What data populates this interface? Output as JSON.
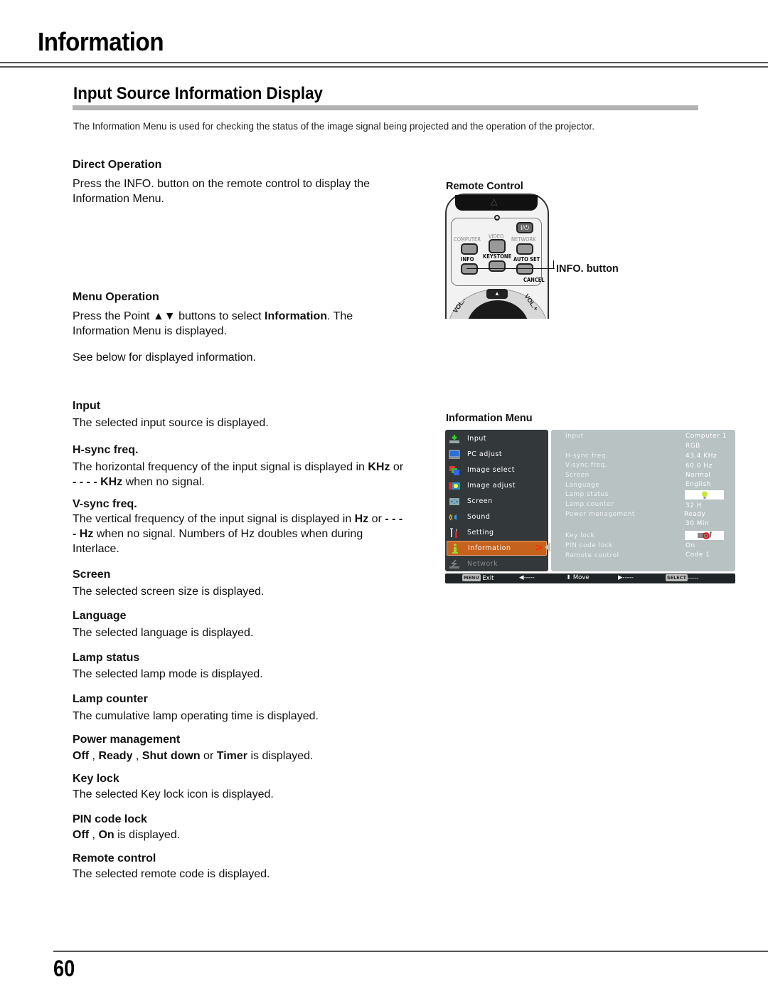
{
  "page": {
    "title": "Information",
    "section_title": "Input Source Information Display",
    "intro": "The Information Menu is used for checking the status of the image signal being projected and the operation of the projector.",
    "page_number": "60"
  },
  "direct_operation": {
    "heading": "Direct Operation",
    "text": "Press the INFO. button on the remote control to display the Information Menu."
  },
  "menu_operation": {
    "heading": "Menu Operation",
    "text_before": "Press the Point ▲▼ buttons to select ",
    "text_bold": "Information",
    "text_after": ". The Information Menu is displayed.",
    "see_below": "See below for displayed information."
  },
  "descriptions": {
    "input": {
      "heading": "Input",
      "text": "The selected input source is displayed."
    },
    "hsync": {
      "heading": "H-sync freq.",
      "t1": "The horizontal frequency of the input signal is displayed in ",
      "b1": "KHz",
      "t2": " or ",
      "b2": "- - - - KHz",
      "t3": " when no signal."
    },
    "vsync": {
      "heading": "V-sync freq.",
      "t1": "The vertical frequency of the input signal is displayed in ",
      "b1": "Hz",
      "t2": " or ",
      "b2": "- - - - Hz",
      "t3": "  when no signal. Numbers of Hz doubles when during Interlace."
    },
    "screen": {
      "heading": "Screen",
      "text": "The selected screen size is displayed."
    },
    "language": {
      "heading": "Language",
      "text": "The selected language is displayed."
    },
    "lamp_status": {
      "heading": "Lamp status",
      "text": "The selected lamp mode is displayed."
    },
    "lamp_counter": {
      "heading": "Lamp counter",
      "text": "The cumulative lamp operating time is displayed."
    },
    "power_management": {
      "heading": "Power management",
      "b1": "Off",
      "t1": " , ",
      "b2": "Ready",
      "t2": " , ",
      "b3": "Shut down",
      "t3": " or ",
      "b4": "Timer",
      "t4": " is displayed."
    },
    "key_lock": {
      "heading": "Key lock",
      "text": "The selected Key lock icon is displayed."
    },
    "pin_code_lock": {
      "heading": "PIN code lock",
      "b1": "Off",
      "t1": " , ",
      "b2": "On",
      "t2": " is displayed."
    },
    "remote_control": {
      "heading": "Remote control",
      "text": "The selected remote code  is displayed."
    }
  },
  "remote_figure": {
    "label": "Remote Control",
    "callout": "INFO. button",
    "buttons": {
      "power": "I/⏻",
      "computer": "COMPUTER",
      "video": "VIDEO",
      "network": "NETWORK",
      "info": "INFO",
      "keystone": "KEYSTONE",
      "auto_set": "AUTO SET",
      "cancel": "CANCEL",
      "vol_minus": "VOL.-",
      "vol_plus": "VOL.+",
      "up": "▲"
    }
  },
  "info_menu_figure": {
    "label": "Information Menu",
    "menu_items": [
      {
        "label": "Input",
        "icon": "input-icon"
      },
      {
        "label": "PC adjust",
        "icon": "pc-adjust-icon"
      },
      {
        "label": "Image select",
        "icon": "image-select-icon"
      },
      {
        "label": "Image adjust",
        "icon": "image-adjust-icon"
      },
      {
        "label": "Screen",
        "icon": "screen-icon"
      },
      {
        "label": "Sound",
        "icon": "sound-icon"
      },
      {
        "label": "Setting",
        "icon": "setting-icon"
      },
      {
        "label": "Information",
        "icon": "information-icon",
        "active": true
      },
      {
        "label": "Network",
        "icon": "network-icon",
        "disabled": true
      }
    ],
    "info_rows": [
      {
        "label": "Input",
        "value": "Computer 1"
      },
      {
        "label": "",
        "value": "RGB"
      },
      {
        "label": "H-sync freq.",
        "value": "43.4 KHz"
      },
      {
        "label": "V-sync freq.",
        "value": "60.0 Hz"
      },
      {
        "label": "Screen",
        "value": "Normal"
      },
      {
        "label": "Language",
        "value": "English"
      },
      {
        "label": "Lamp status",
        "value": "lamp-bulb-icon"
      },
      {
        "label": "Lamp counter",
        "value": "32 H"
      },
      {
        "label": "Power management",
        "value": "Ready"
      },
      {
        "label": "",
        "value": "30  Min"
      },
      {
        "label": "Key lock",
        "value": "key-lock-projector-icon"
      },
      {
        "label": "PIN code lock",
        "value": "On"
      },
      {
        "label": "Remote control",
        "value": "Code 1"
      }
    ],
    "footer": {
      "menu_key": "MENU",
      "exit": "Exit",
      "left": "◀-----",
      "move_icon": "⬍",
      "move": "Move",
      "right": "▶-----",
      "select_key": "SELECT",
      "select": "-----"
    },
    "colors": {
      "menu_bg": "#33383b",
      "panel_bg": "#b8c2c2",
      "active_bg": "#c4621e",
      "arrow": "#ff2a00",
      "footer_bg": "#1f2426"
    }
  }
}
